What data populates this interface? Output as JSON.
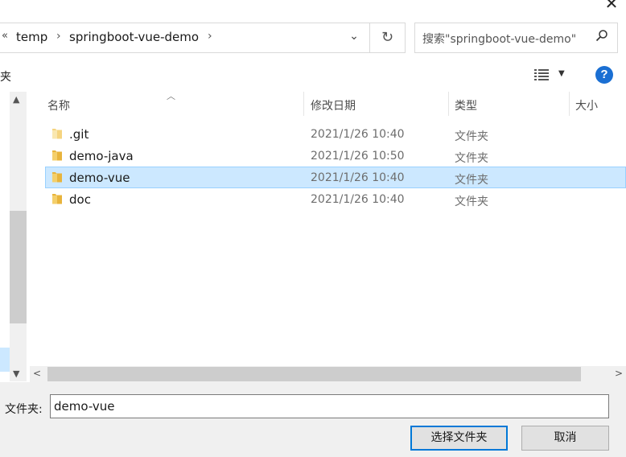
{
  "window": {
    "close_glyph": "✕"
  },
  "address_bar": {
    "overflow_glyph": "«",
    "crumbs": [
      "temp",
      "springboot-vue-demo"
    ],
    "separator_glyph": "›",
    "dropdown_glyph": "⌄",
    "refresh_glyph": "↻"
  },
  "search": {
    "placeholder": "搜索\"springboot-vue-demo\"",
    "icon_glyph": "⌕"
  },
  "toolbar": {
    "left_label": "夹",
    "help_glyph": "?"
  },
  "columns": {
    "name": "名称",
    "date": "修改日期",
    "type": "类型",
    "size": "大小"
  },
  "rows": [
    {
      "name": ".git",
      "date": "2021/1/26 10:40",
      "type": "文件夹",
      "selected": false
    },
    {
      "name": "demo-java",
      "date": "2021/1/26 10:50",
      "type": "文件夹",
      "selected": false
    },
    {
      "name": "demo-vue",
      "date": "2021/1/26 10:40",
      "type": "文件夹",
      "selected": true
    },
    {
      "name": "doc",
      "date": "2021/1/26 10:40",
      "type": "文件夹",
      "selected": false
    }
  ],
  "footer": {
    "folder_label": "文件夹:",
    "folder_value": "demo-vue",
    "select_button": "选择文件夹",
    "cancel_button": "取消"
  },
  "colors": {
    "selection": "#cce8ff",
    "selection_border": "#99d1ff",
    "accent": "#0078d7",
    "folder": "#e8b43c"
  }
}
